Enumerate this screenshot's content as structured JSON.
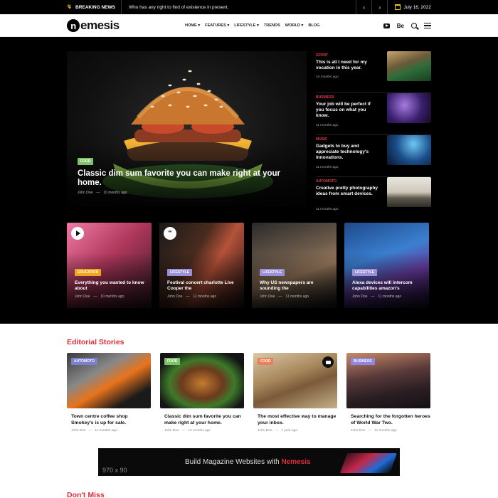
{
  "topbar": {
    "breaking_label": "BREAKING NEWS",
    "breaking_text": "Who has any right to find of existence in present.",
    "prev_icon": "chevron-left-icon",
    "next_icon": "chevron-right-icon",
    "date": "July 16, 2022"
  },
  "header": {
    "logo_mark": "n",
    "logo_rest": "emesis",
    "nav": [
      "HOME",
      "FEATURES",
      "LIFESTYLE",
      "TRENDS",
      "WORLD",
      "BLOG"
    ],
    "nav_dropdown": [
      true,
      true,
      true,
      false,
      true,
      false
    ],
    "behance_label": "Be"
  },
  "hero": {
    "tag": "FOOD",
    "title": "Classic dim sum favorite you can make right at your home.",
    "author": "John Doe",
    "time": "10 months ago"
  },
  "side_posts": [
    {
      "category": "SPORT",
      "title": "This is all I need for my vocation in this year.",
      "time": "10 months ago"
    },
    {
      "category": "BUSINESS",
      "title": "Your job will be perfect if you focus on what you know.",
      "time": "11 months ago"
    },
    {
      "category": "MUSIC",
      "title": "Gadgets to buy and appreciate technology's innovations.",
      "time": "11 months ago"
    },
    {
      "category": "AUTOMOTO",
      "title": "Creative pretty photography ideas from smart devices.",
      "time": "11 months ago"
    }
  ],
  "cards": [
    {
      "tag": "EDUCATION",
      "title": "Everything you wanted to know about",
      "author": "John Doe",
      "time": "10 months ago"
    },
    {
      "tag": "LIFESTYLE",
      "title": "Festival concert charlotte Live Cooper the",
      "author": "John Doe",
      "time": "11 months ago"
    },
    {
      "tag": "LIFESTYLE",
      "title": "Why US newspapers are sounding the",
      "author": "John Doe",
      "time": "11 months ago"
    },
    {
      "tag": "LIFESTYLE",
      "title": "Alexa devices will intercom capabilities amazon's",
      "author": "John Doe",
      "time": "11 months ago"
    }
  ],
  "editorial": {
    "heading": "Editorial Stories",
    "items": [
      {
        "tag": "AUTOMOTO",
        "title": "Town centre coffee shop Smokey's is up for sale.",
        "author": "John Doe",
        "time": "11 months ago"
      },
      {
        "tag": "FOOD",
        "title": "Classic dim sum favorite you can make right at your home.",
        "author": "John Doe",
        "time": "10 months ago"
      },
      {
        "tag": "FOOD",
        "title": "The most effective way to manage your inbox.",
        "author": "John Doe",
        "time": "1 year ago"
      },
      {
        "tag": "BUSINESS",
        "title": "Searching for the forgotten heroes of World War Two.",
        "author": "John Doe",
        "time": "11 months ago"
      }
    ]
  },
  "ad": {
    "size": "970 x 90",
    "text": "Build Magazine Websites with",
    "brand": "Nemesis"
  },
  "dont_miss": {
    "heading": "Don't Miss"
  },
  "colors": {
    "accent": "#e02d3c",
    "food": "#7ec36a",
    "automoto": "#7b7fcf",
    "education": "#f2a31c",
    "lifestyle": "#9a8fd8",
    "business": "#8e86e0"
  }
}
